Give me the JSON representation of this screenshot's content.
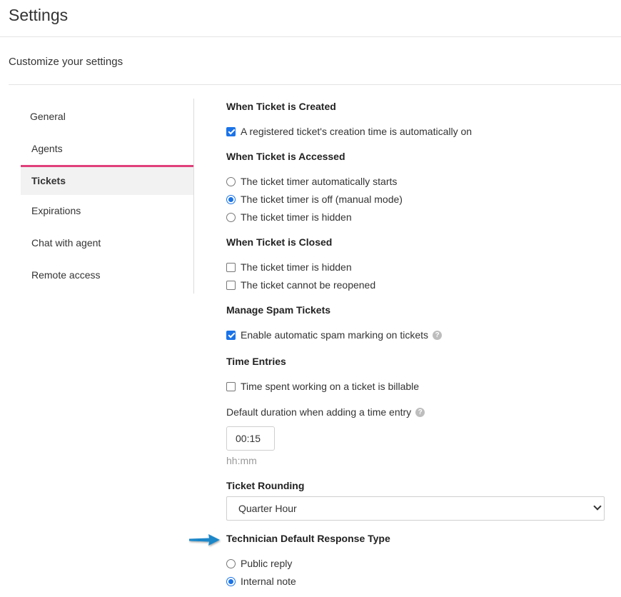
{
  "header": {
    "title": "Settings",
    "subtitle": "Customize your settings"
  },
  "sidebar": {
    "items": [
      {
        "label": "General",
        "active": false
      },
      {
        "label": "Agents",
        "active": false
      },
      {
        "label": "Tickets",
        "active": true
      },
      {
        "label": "Expirations",
        "active": false
      },
      {
        "label": "Chat with agent",
        "active": false
      },
      {
        "label": "Remote access",
        "active": false
      }
    ],
    "active_color": "#e0407a"
  },
  "created": {
    "heading": "When Ticket is Created",
    "option": {
      "label": "A registered ticket's creation time is automatically on",
      "checked": true
    }
  },
  "accessed": {
    "heading": "When Ticket is Accessed",
    "options": [
      {
        "label": "The ticket timer automatically starts",
        "selected": false
      },
      {
        "label": "The ticket timer is off (manual mode)",
        "selected": true
      },
      {
        "label": "The ticket timer is hidden",
        "selected": false
      }
    ]
  },
  "closed": {
    "heading": "When Ticket is Closed",
    "options": [
      {
        "label": "The ticket timer is hidden",
        "checked": false
      },
      {
        "label": "The ticket cannot be reopened",
        "checked": false
      }
    ]
  },
  "spam": {
    "heading": "Manage Spam Tickets",
    "option": {
      "label": "Enable automatic spam marking on tickets",
      "checked": true
    }
  },
  "time_entries": {
    "heading": "Time Entries",
    "billable": {
      "label": "Time spent working on a ticket is billable",
      "checked": false
    },
    "duration_label": "Default duration when adding a time entry",
    "duration_value": "00:15",
    "duration_hint": "hh:mm"
  },
  "rounding": {
    "heading": "Ticket Rounding",
    "selected": "Quarter Hour"
  },
  "response_type": {
    "heading": "Technician Default Response Type",
    "options": [
      {
        "label": "Public reply",
        "selected": false
      },
      {
        "label": "Internal note",
        "selected": true
      }
    ]
  },
  "colors": {
    "accent": "#1a73e8",
    "arrow": "#1b87c9"
  },
  "icons": {
    "help": "question-circle-icon",
    "pointer": "arrow-right-icon"
  }
}
